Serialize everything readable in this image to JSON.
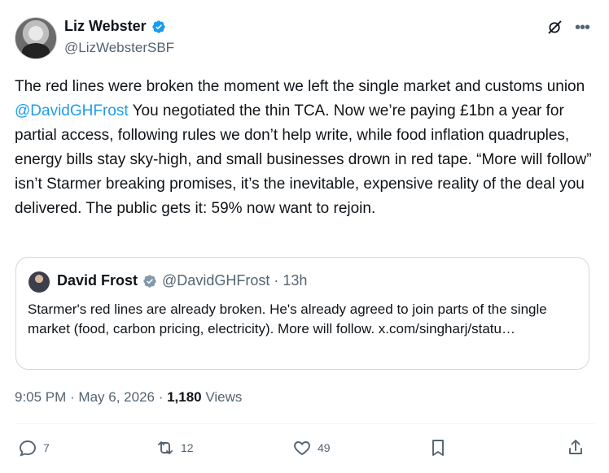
{
  "author": {
    "name": "Liz Webster",
    "handle": "@LizWebsterSBF"
  },
  "tweet": {
    "text_part1": "The red lines were broken the moment we left the single market and customs union ",
    "mention": "@DavidGHFrost",
    "text_part2": "  You negotiated the thin TCA. Now we’re paying £1bn a year for partial access, following rules we don’t help write, while food inflation quadruples, energy bills stay sky-high, and small businesses drown in red tape. “More will follow” isn’t Starmer breaking promises, it’s the inevitable, expensive reality of the deal you delivered. The public gets it: 59% now want to rejoin.",
    "timestamp": "9:05 PM · May 6, 2026 · ",
    "views_count": "1,180",
    "views_label": " Views"
  },
  "quote": {
    "name": "David Frost",
    "meta": "@DavidGHFrost · 13h",
    "text": "Starmer's red lines are already broken.  He's already agreed to join parts of the single market (food, carbon pricing, electricity).  More will follow. x.com/singharj/statu…"
  },
  "actions": {
    "replies": "7",
    "reposts": "12",
    "likes": "49"
  },
  "colors": {
    "accent": "#1d9bf0",
    "muted": "#536471",
    "text": "#0f1419"
  }
}
